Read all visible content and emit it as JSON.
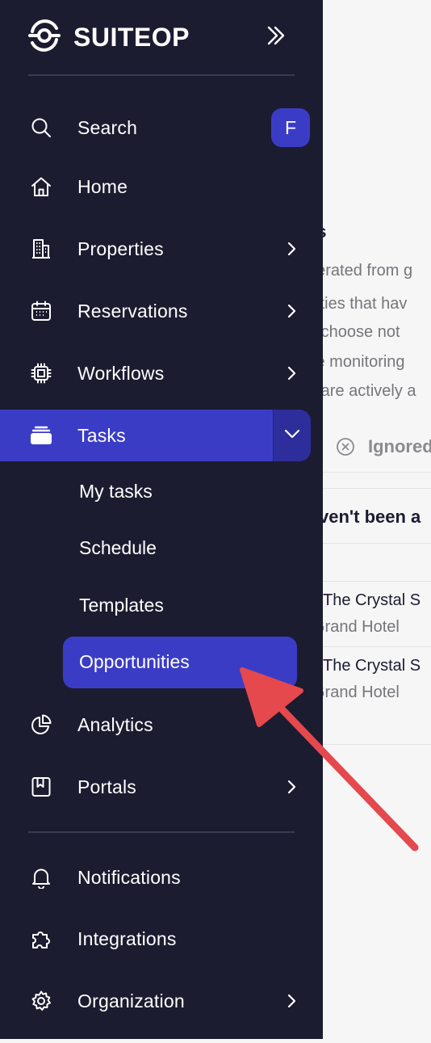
{
  "brand": {
    "name": "SUITEOP"
  },
  "user": {
    "avatar_initial": "F"
  },
  "nav": {
    "search": "Search",
    "home": "Home",
    "properties": "Properties",
    "reservations": "Reservations",
    "workflows": "Workflows",
    "tasks": "Tasks",
    "tasks_sub": {
      "my_tasks": "My tasks",
      "schedule": "Schedule",
      "templates": "Templates",
      "opportunities": "Opportunities"
    },
    "analytics": "Analytics",
    "portals": "Portals",
    "notifications": "Notifications",
    "integrations": "Integrations",
    "organization": "Organization"
  },
  "content": {
    "heading_fragment": "ks",
    "desc_lines": [
      "nerated from g",
      "nities that hav",
      "u choose not",
      "'re monitoring",
      "u are actively a"
    ],
    "tab_ignored": "Ignored",
    "section_title_fragment": "ven't been a",
    "rows": [
      {
        "title": "The Crystal S",
        "subtitle": "Grand Hotel"
      },
      {
        "title": "The Crystal S",
        "subtitle": "Grand Hotel"
      }
    ]
  },
  "colors": {
    "sidebar": "#1b1c30",
    "accent": "#3b3cc6",
    "arrow": "#e5484d"
  }
}
